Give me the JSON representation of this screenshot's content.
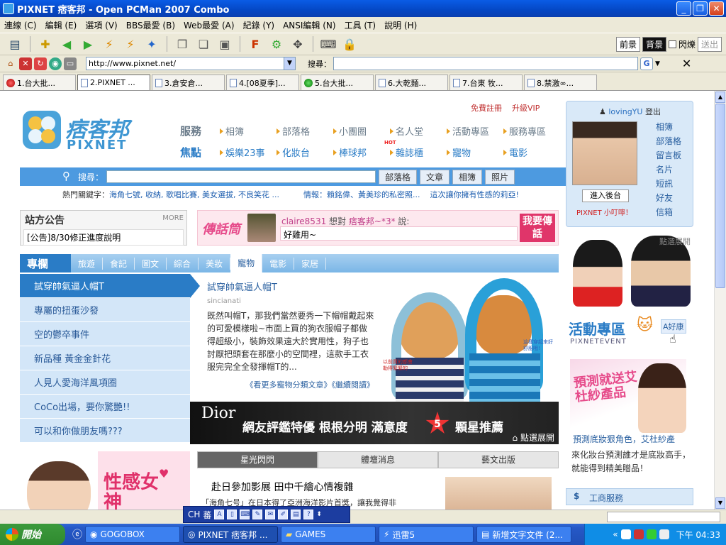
{
  "window": {
    "title": "PIXNET 痞客邦 - Open PCMan 2007 Combo",
    "minimize": "_",
    "maximize": "❐",
    "close": "✕"
  },
  "menu": [
    "連線 (C)",
    "編輯 (E)",
    "選項 (V)",
    "BBS最愛 (B)",
    "Web最愛 (A)",
    "紀錄 (Y)",
    "ANSI編輯 (N)",
    "工具 (T)",
    "說明 (H)"
  ],
  "toolbar": {
    "fg_label": "前景",
    "bg_label": "背景",
    "blink_label": "閃爍",
    "send_label": "送出"
  },
  "address": {
    "url": "http://www.pixnet.net/",
    "search_label": "搜尋："
  },
  "tabs": [
    {
      "label": "1.台大批...",
      "icon": "red-dot"
    },
    {
      "label": "2.PIXNET ...",
      "icon": "doc"
    },
    {
      "label": "3.倉安倉...",
      "icon": "doc"
    },
    {
      "label": "4.[08夏季]...",
      "icon": "doc"
    },
    {
      "label": "5.台大批...",
      "icon": "green-dot"
    },
    {
      "label": "6.大乾麵...",
      "icon": "doc"
    },
    {
      "label": "7.台東 牧...",
      "icon": "doc"
    },
    {
      "label": "8.禁激∞...",
      "icon": "doc"
    }
  ],
  "page": {
    "logo_cn": "痞客邦",
    "logo_en": "PIXNET",
    "top_links": {
      "register": "免費註冊",
      "vip": "升級VIP"
    },
    "service_label": "服務",
    "service_items": [
      "相簿",
      "部落格",
      "小團圈",
      "名人堂",
      "活動專區",
      "服務專區"
    ],
    "focus_label": "焦點",
    "focus_items": [
      "娛樂23事",
      "化妝台",
      "棒球邦",
      "雜誌櫃",
      "寵物",
      "電影"
    ],
    "hot_badge": "HOT",
    "search": {
      "label": "搜尋：",
      "buttons": [
        "部落格",
        "文章",
        "相簿",
        "照片"
      ]
    },
    "keywords": {
      "label": "熱門關鍵字：",
      "text": "海角七號, 收納, 歌唱比賽, 美女選拔, 不良笑花 ...",
      "info": "情報：賴銘偉、黃美珍的私密照...",
      "info2": "這次讓你擁有性感的莉亞!"
    },
    "notice": {
      "title": "站方公告",
      "more": "MORE",
      "body": "[公告]8/30修正進度說明"
    },
    "chat": {
      "banner": "傳話筒",
      "user": "claire8531",
      "mid": "想對",
      "target": "痞客邦~*3*",
      "said": "說:",
      "message": "好雞用~",
      "button": "我要傳話"
    },
    "columns": {
      "label": "專欄",
      "tabs": [
        "旅遊",
        "食記",
        "圖文",
        "綜合",
        "美妝",
        "寵物",
        "電影",
        "家居"
      ],
      "active": "寵物"
    },
    "articles": [
      "試穿帥氣逼人帽T",
      "專屬的扭蛋沙發",
      "空的鬱卒事件",
      "新品種 黃金金針花",
      "人見人愛海洋風項圈",
      "CoCo出場，要你驚艷!!",
      "可以和你做朋友嗎???"
    ],
    "feature": {
      "title": "試穿帥氣逼人帽T",
      "author": "sincianati",
      "body": "既然叫帽T，那我們當然要秀一下帽帽戴起來的可愛模樣啦~市面上買的狗衣服帽子都做得超級小，裝飾效果遠大於實用性，狗子也討厭把頭套在那麼小的空間裡，這款手工衣服完完全全發揮帽T的...",
      "links": "《看更多寵物分類文章》《繼續閱讀》"
    },
    "dog_notes": {
      "left": "以前買的都會勒得緊緊的",
      "right": "這樣穿起來好舒服哦!"
    },
    "dior": {
      "brand": "Dior",
      "text": "網友評鑑特優 根根分明 滿意度",
      "stars": "5",
      "text2": "顆星推薦",
      "expand": "點選展開"
    },
    "promo_text": "性感女神",
    "star_tabs": [
      "星光閃閃",
      "體壇消息",
      "藝文出版"
    ],
    "news": {
      "title": "赴日參加影展 田中千繪心情複雜",
      "body": "「海角七号」在日本得了亞洲海洋影片首獎，讓我覺得非"
    },
    "login": {
      "user": "lovingYU",
      "logout": "登出",
      "links": [
        "相簿",
        "部落格",
        "留言板",
        "名片",
        "短訊",
        "好友",
        "信箱"
      ],
      "backend": "進入後台",
      "nick": "PIXNET 小叮嚀！"
    },
    "photo_expand": "點選展開",
    "event": {
      "title": "活動專區",
      "sub": "PIXNETEVENT",
      "badge": "A好康",
      "caption": "預測底妝狠角色，艾杜紗產",
      "desc": "來化妝台預測誰才是底妝高手，就能得到精美贈品！",
      "promo": "預測就送艾杜紗產品"
    },
    "biz": "工商服務"
  },
  "floatbar": {
    "ch": "CH",
    "fw": "蕃"
  },
  "taskbar": {
    "start": "開始",
    "items": [
      "GOGOBOX",
      "PIXNET 痞客邦 ...",
      "GAMES",
      "迅雷5",
      "新增文字文件 (2..."
    ],
    "clock": "下午 04:33"
  }
}
